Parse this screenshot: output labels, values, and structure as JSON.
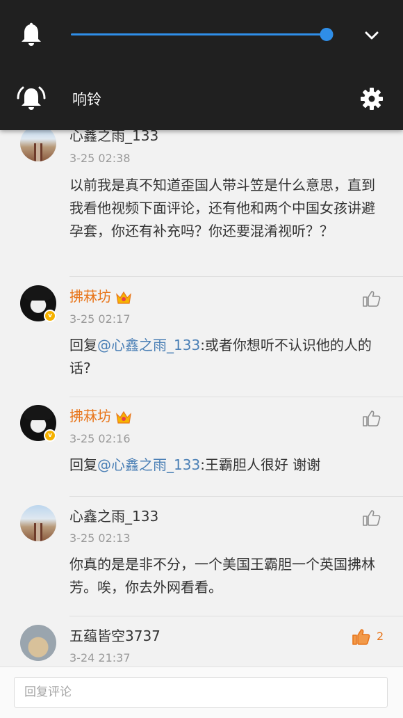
{
  "volume_panel": {
    "level": 0.98,
    "mode_label": "响铃",
    "accent": "#2f8ee8",
    "icons": [
      "bell-icon",
      "chevron-down-icon",
      "bell-ringing-icon",
      "gear-icon"
    ]
  },
  "comments": [
    {
      "username": "心鑫之雨_133",
      "time": "3-25 02:38",
      "text": "以前我是真不知道歪国人带斗笠是什么意思，直到我看他视频下面评论，还有他和两个中国女孩讲避孕套，你还有补充吗？你还要混淆视听？？"
    },
    {
      "username": "拂菻坊",
      "time": "3-25 02:17",
      "reply_prefix": "回复",
      "mention": "@心鑫之雨_133",
      "text": ":或者你想听不认识他的人的话?"
    },
    {
      "username": "拂菻坊",
      "time": "3-25 02:16",
      "reply_prefix": "回复",
      "mention": "@心鑫之雨_133",
      "text": ":王霸胆人很好 谢谢"
    },
    {
      "username": "心鑫之雨_133",
      "time": "3-25 02:13",
      "text": "你真的是是非不分，一个美国王霸胆一个英国拂林芳。唉，你去外网看看。"
    },
    {
      "username": "五蕴皆空3737",
      "time": "3-24 21:37",
      "like_count": "2"
    }
  ],
  "reply_bar": {
    "placeholder": "回复评论"
  },
  "colors": {
    "vip_name": "#e8751a",
    "mention": "#4a7fb5",
    "liked": "#e8751a"
  }
}
